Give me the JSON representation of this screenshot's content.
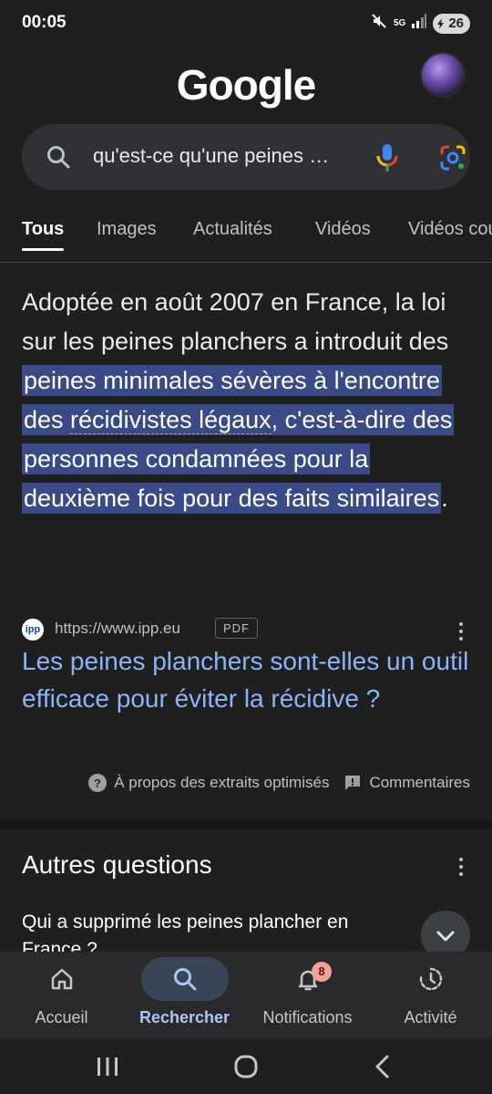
{
  "status_bar": {
    "time": "00:05",
    "network": "5G",
    "battery": "26"
  },
  "header": {
    "logo": "Google"
  },
  "search": {
    "query": "qu'est-ce qu'une peines planchers"
  },
  "tabs": [
    {
      "label": "Tous",
      "active": true
    },
    {
      "label": "Images"
    },
    {
      "label": "Actualités"
    },
    {
      "label": "Vidéos"
    },
    {
      "label": "Vidéos courtes"
    }
  ],
  "featured_snippet": {
    "text_before": "Adoptée en août 2007 en France, la loi sur les peines planchers a introduit des ",
    "highlight_1": "peines minimales sévères à l'encontre des ",
    "underlined": "récidivistes légaux",
    "highlight_2": ", c'est-à-dire des personnes condamnées pour la deuxième fois pour des faits similaires",
    "text_after": ".",
    "source_favicon": "ipp",
    "source_url": "https://www.ipp.eu",
    "source_type": "PDF",
    "result_title": "Les peines planchers sont-elles un outil efficace pour éviter la récidive ?",
    "about_label": "À propos des extraits optimisés",
    "feedback_label": "Commentaires"
  },
  "other_questions": {
    "title": "Autres questions",
    "items": [
      "Qui a supprimé les peines plancher en France ?"
    ]
  },
  "bottom_nav": [
    {
      "label": "Accueil",
      "icon": "home-icon"
    },
    {
      "label": "Rechercher",
      "icon": "search-icon",
      "active": true
    },
    {
      "label": "Notifications",
      "icon": "bell-icon",
      "badge": "8"
    },
    {
      "label": "Activité",
      "icon": "history-icon"
    }
  ],
  "colors": {
    "background": "#1f1f1f",
    "link": "#8ab4f8",
    "highlight": "#394a87",
    "active_nav": "#a8c7fa"
  }
}
